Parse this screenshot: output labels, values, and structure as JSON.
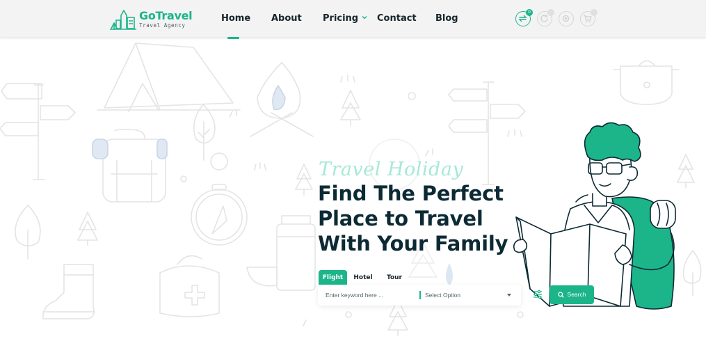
{
  "brand": {
    "name": "GoTravel",
    "tagline": "Travel Agency",
    "accent_color": "#1cb58a",
    "light_accent_color": "#a6e8d6"
  },
  "nav": {
    "items": [
      {
        "label": "Home",
        "active": true
      },
      {
        "label": "About"
      },
      {
        "label": "Pricing",
        "has_dropdown": true
      },
      {
        "label": "Contact"
      },
      {
        "label": "Blog"
      }
    ]
  },
  "header_icons": [
    {
      "icon": "swap-icon",
      "badge": "0"
    },
    {
      "icon": "refresh-icon",
      "badge": ""
    },
    {
      "icon": "eye-icon",
      "badge": ""
    },
    {
      "icon": "cart-icon",
      "badge": ""
    }
  ],
  "hero": {
    "script_title": "Travel Holiday",
    "headline_lines": [
      "Find The Perfect",
      "Place to Travel",
      "With Your Family"
    ]
  },
  "search": {
    "tabs": [
      {
        "label": "Flight",
        "active": true
      },
      {
        "label": "Hotel"
      },
      {
        "label": "Tour"
      }
    ],
    "keyword_placeholder": "Enter keyword here ...",
    "select_value": "Select Option",
    "button_label": "Search"
  }
}
